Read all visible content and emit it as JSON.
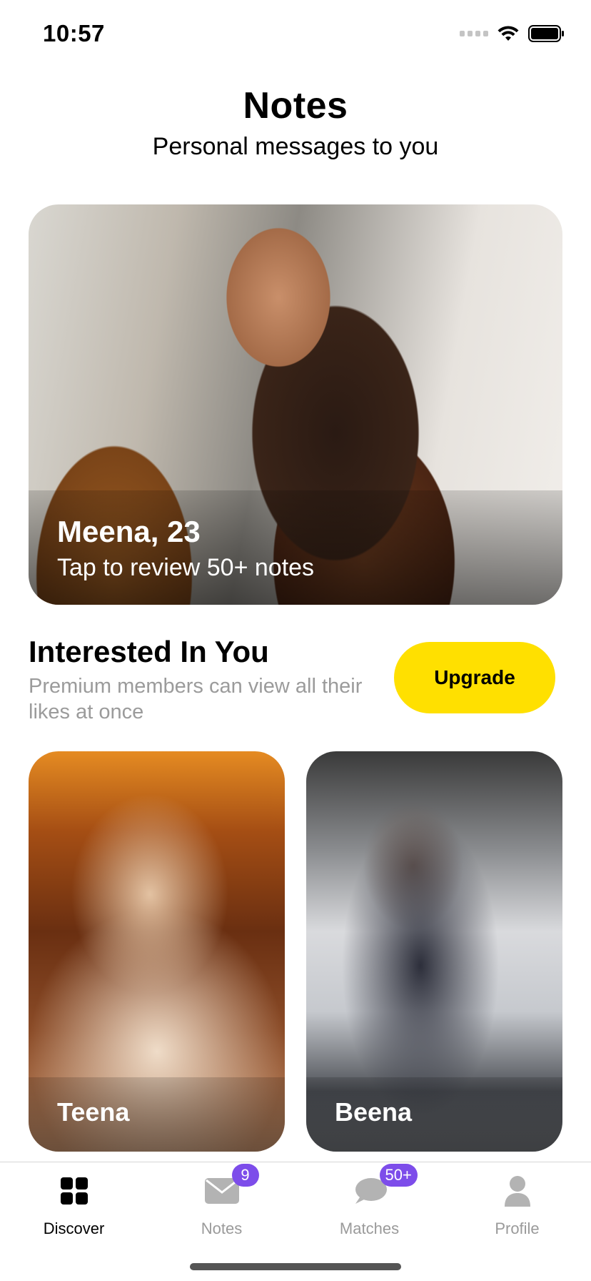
{
  "status_bar": {
    "time": "10:57"
  },
  "header": {
    "title": "Notes",
    "subtitle": "Personal messages to you"
  },
  "hero": {
    "name": "Meena, 23",
    "subtitle": "Tap to review 50+ notes"
  },
  "interested": {
    "title": "Interested In You",
    "description": "Premium members can view all their likes at once",
    "upgrade_label": "Upgrade"
  },
  "likes": [
    {
      "name": "Teena"
    },
    {
      "name": "Beena"
    }
  ],
  "tabs": [
    {
      "label": "Discover",
      "icon": "grid-icon",
      "active": true
    },
    {
      "label": "Notes",
      "icon": "envelope-icon",
      "badge": "9"
    },
    {
      "label": "Matches",
      "icon": "chat-bubble-icon",
      "badge": "50+"
    },
    {
      "label": "Profile",
      "icon": "person-icon"
    }
  ],
  "colors": {
    "accent_yellow": "#ffe000",
    "badge_purple": "#7d4dea",
    "muted_gray": "#9b9b9b"
  }
}
